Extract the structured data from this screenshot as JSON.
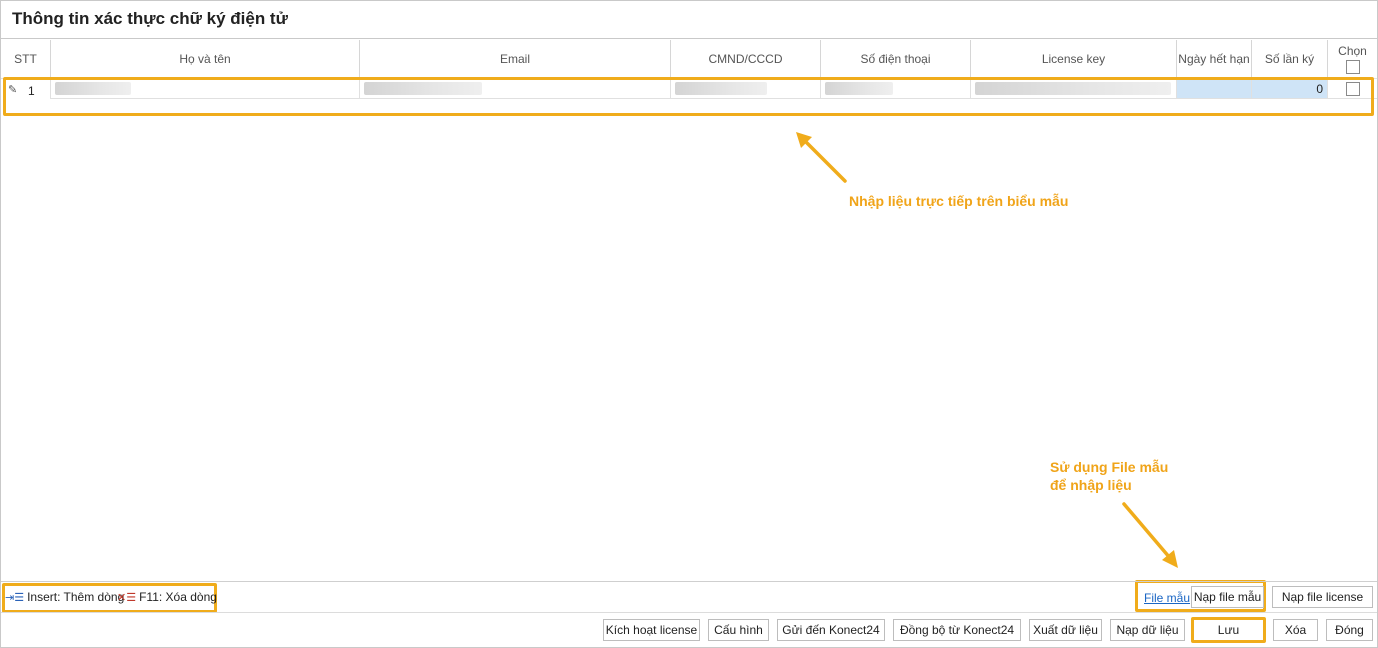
{
  "window": {
    "title": "Thông tin xác thực chữ ký điện tử"
  },
  "grid": {
    "columns": [
      "STT",
      "Họ và tên",
      "Email",
      "CMND/CCCD",
      "Số điện thoại",
      "License key",
      "Ngày hết hạn",
      "Số lần ký",
      "Chọn"
    ],
    "rows": [
      {
        "stt": "1",
        "so_lan_ky": "0"
      }
    ]
  },
  "annotations": {
    "direct_input": "Nhập liệu trực tiếp trên biểu mẫu",
    "file_template_line1": "Sử dụng File mẫu",
    "file_template_line2": "để nhập liệu"
  },
  "shortcuts": {
    "insert": "Insert: Thêm dòng",
    "delete": "F11: Xóa dòng"
  },
  "toolbar": {
    "file_mau_link": "File mẫu",
    "nap_file_mau": "Nạp file mẫu",
    "nap_file_license": "Nạp file license",
    "kich_hoat_license": "Kích hoạt license",
    "cau_hinh": "Cấu hình",
    "gui_den_konect24": "Gửi đến Konect24",
    "dong_bo_tu_konect24": "Đồng bộ từ Konect24",
    "xuat_du_lieu": "Xuất dữ liệu",
    "nap_du_lieu": "Nạp dữ liệu",
    "luu": "Lưu",
    "xoa": "Xóa",
    "dong": "Đóng"
  },
  "colors": {
    "highlight": "#f0ac1b",
    "annotation": "#f0a419",
    "selected_cell": "#cfe4f7",
    "link": "#1a66c4"
  }
}
